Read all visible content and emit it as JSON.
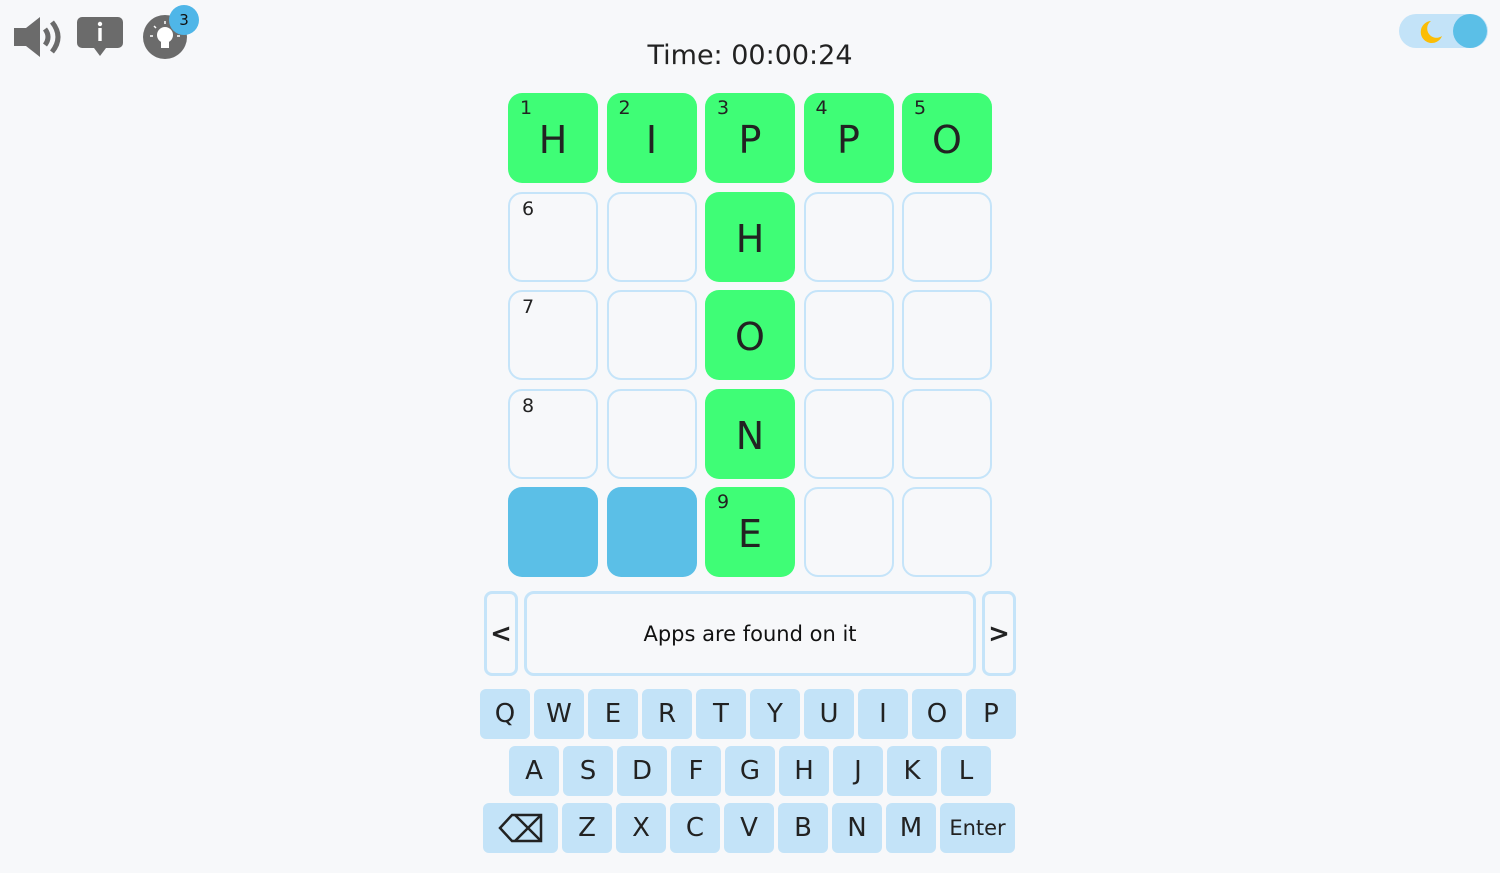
{
  "toolbar": {
    "sound_icon": "speaker-icon",
    "info_icon": "info-icon",
    "hint_icon": "lightbulb-icon",
    "hint_count": "3"
  },
  "theme_toggle": {
    "icon": "moon-icon",
    "mode": "dark-mode-off"
  },
  "timer": {
    "text": "Time: 00:00:24"
  },
  "colors": {
    "solved": "#3ffd76",
    "blocked": "#5bbfe7",
    "key": "#c3e3f8",
    "border": "#c5e4f9"
  },
  "grid": {
    "cells": [
      {
        "num": "1",
        "letter": "H",
        "state": "filled"
      },
      {
        "num": "2",
        "letter": "I",
        "state": "filled"
      },
      {
        "num": "3",
        "letter": "P",
        "state": "filled"
      },
      {
        "num": "4",
        "letter": "P",
        "state": "filled"
      },
      {
        "num": "5",
        "letter": "O",
        "state": "filled"
      },
      {
        "num": "6",
        "letter": "",
        "state": "empty"
      },
      {
        "num": "",
        "letter": "",
        "state": "empty"
      },
      {
        "num": "",
        "letter": "H",
        "state": "filled"
      },
      {
        "num": "",
        "letter": "",
        "state": "empty"
      },
      {
        "num": "",
        "letter": "",
        "state": "empty"
      },
      {
        "num": "7",
        "letter": "",
        "state": "empty"
      },
      {
        "num": "",
        "letter": "",
        "state": "empty"
      },
      {
        "num": "",
        "letter": "O",
        "state": "filled"
      },
      {
        "num": "",
        "letter": "",
        "state": "empty"
      },
      {
        "num": "",
        "letter": "",
        "state": "empty"
      },
      {
        "num": "8",
        "letter": "",
        "state": "empty"
      },
      {
        "num": "",
        "letter": "",
        "state": "empty"
      },
      {
        "num": "",
        "letter": "N",
        "state": "filled"
      },
      {
        "num": "",
        "letter": "",
        "state": "empty"
      },
      {
        "num": "",
        "letter": "",
        "state": "empty"
      },
      {
        "num": "",
        "letter": "",
        "state": "blocked"
      },
      {
        "num": "",
        "letter": "",
        "state": "blocked"
      },
      {
        "num": "9",
        "letter": "E",
        "state": "filled"
      },
      {
        "num": "",
        "letter": "",
        "state": "empty"
      },
      {
        "num": "",
        "letter": "",
        "state": "empty"
      }
    ]
  },
  "clue": {
    "prev": "<",
    "next": ">",
    "text": "Apps are found on it"
  },
  "keyboard": {
    "rows": [
      [
        "Q",
        "W",
        "E",
        "R",
        "T",
        "Y",
        "U",
        "I",
        "O",
        "P"
      ],
      [
        "A",
        "S",
        "D",
        "F",
        "G",
        "H",
        "J",
        "K",
        "L"
      ],
      [
        "⌫",
        "Z",
        "X",
        "C",
        "V",
        "B",
        "N",
        "M",
        "Enter"
      ]
    ]
  }
}
